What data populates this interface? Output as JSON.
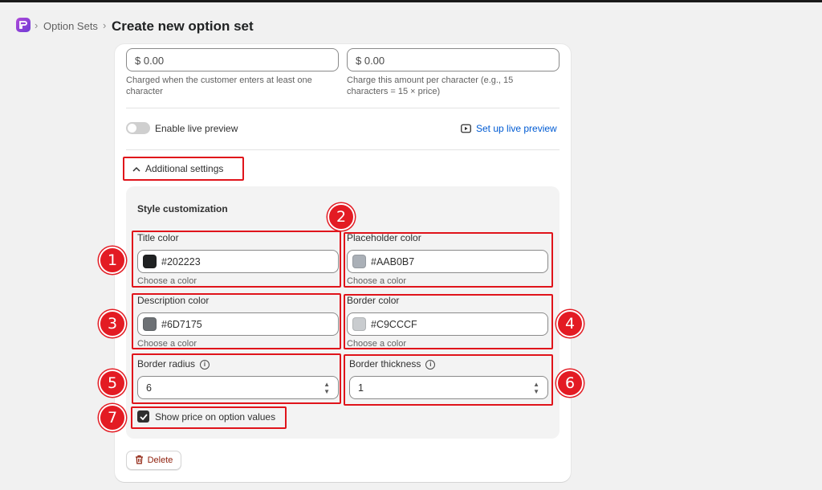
{
  "breadcrumb": {
    "parent": "Option Sets",
    "title": "Create new option set"
  },
  "pricing": {
    "left_value": "$ 0.00",
    "left_help": "Charged when the customer enters at least one character",
    "right_value": "$ 0.00",
    "right_help": "Charge this amount per character (e.g., 15 characters = 15 × price)"
  },
  "preview": {
    "toggle_label": "Enable live preview",
    "toggle_on": false,
    "link_label": "Set up live preview"
  },
  "additional_settings": {
    "label": "Additional settings",
    "expanded": true
  },
  "style": {
    "title": "Style customization",
    "choose_hint": "Choose a color",
    "title_color": {
      "label": "Title color",
      "value": "#202223",
      "swatch": "#202223"
    },
    "placeholder_color": {
      "label": "Placeholder color",
      "value": "#AAB0B7",
      "swatch": "#AAB0B7"
    },
    "description_color": {
      "label": "Description color",
      "value": "#6D7175",
      "swatch": "#6D7175"
    },
    "border_color": {
      "label": "Border color",
      "value": "#C9CCCF",
      "swatch": "#C9CCCF"
    },
    "border_radius": {
      "label": "Border radius",
      "value": "6"
    },
    "border_thickness": {
      "label": "Border thickness",
      "value": "1"
    },
    "show_price": {
      "label": "Show price on option values",
      "checked": true
    }
  },
  "delete_label": "Delete",
  "markers": [
    "1",
    "2",
    "3",
    "4",
    "5",
    "6",
    "7"
  ],
  "colors": {
    "annotation_red": "#e31b23",
    "link_blue": "#005bd3",
    "danger": "#8e1f0b"
  }
}
